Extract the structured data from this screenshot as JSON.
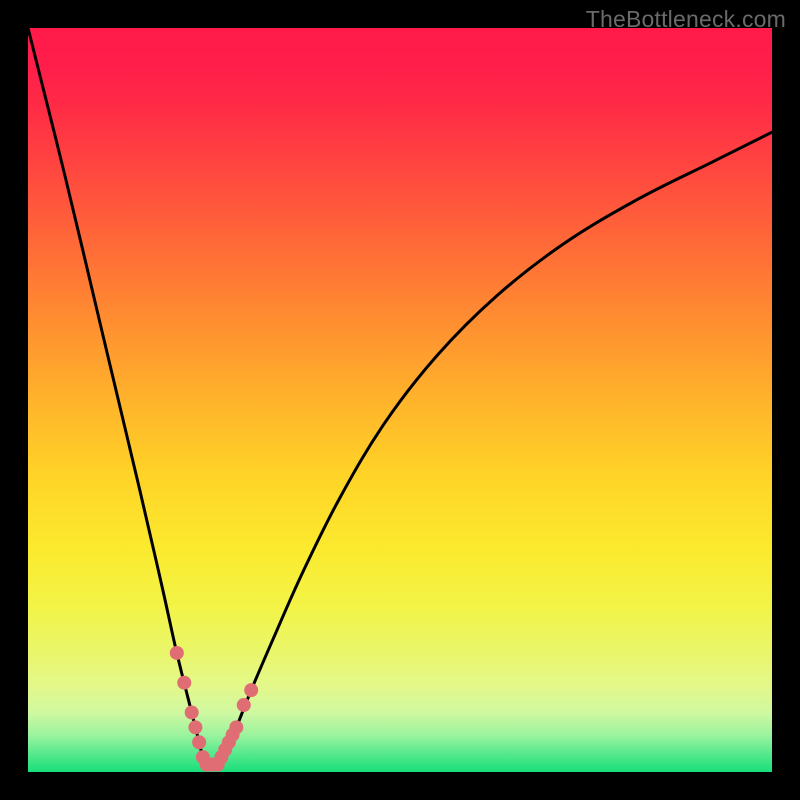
{
  "watermark": "TheBottleneck.com",
  "chart_data": {
    "type": "line",
    "title": "",
    "xlabel": "",
    "ylabel": "",
    "xlim": [
      0,
      100
    ],
    "ylim": [
      0,
      100
    ],
    "series": [
      {
        "name": "curve",
        "x": [
          0,
          5,
          10,
          15,
          18,
          20,
          22,
          23,
          23.5,
          24,
          24.5,
          25,
          25.5,
          26,
          27,
          28,
          30,
          33,
          37,
          42,
          48,
          55,
          63,
          72,
          82,
          92,
          100
        ],
        "values": [
          100,
          80,
          59,
          38,
          25,
          16,
          8,
          4,
          2,
          1,
          1,
          1,
          1,
          2,
          4,
          6,
          11,
          18,
          27,
          37,
          47,
          56,
          64,
          71,
          77,
          82,
          86
        ]
      }
    ],
    "markers": {
      "x": [
        20,
        21,
        22,
        22.5,
        23,
        23.5,
        24,
        24.5,
        25,
        25.5,
        26,
        26.5,
        27,
        27.5,
        28,
        29,
        30
      ],
      "values": [
        16,
        12,
        8,
        6,
        4,
        2,
        1,
        1,
        1,
        1,
        2,
        3,
        4,
        5,
        6,
        9,
        11
      ]
    },
    "gradient_stops": [
      {
        "offset": 0,
        "color": "#ff1a4a"
      },
      {
        "offset": 0.05,
        "color": "#ff1e4a"
      },
      {
        "offset": 0.1,
        "color": "#ff2946"
      },
      {
        "offset": 0.2,
        "color": "#ff4a3f"
      },
      {
        "offset": 0.3,
        "color": "#ff6d37"
      },
      {
        "offset": 0.4,
        "color": "#ff9030"
      },
      {
        "offset": 0.5,
        "color": "#ffb32b"
      },
      {
        "offset": 0.6,
        "color": "#ffd327"
      },
      {
        "offset": 0.7,
        "color": "#fbea2e"
      },
      {
        "offset": 0.78,
        "color": "#f2f448"
      },
      {
        "offset": 0.84,
        "color": "#e9f66b"
      },
      {
        "offset": 0.885,
        "color": "#e3f88a"
      },
      {
        "offset": 0.92,
        "color": "#d0f8a0"
      },
      {
        "offset": 0.95,
        "color": "#9cf39e"
      },
      {
        "offset": 0.975,
        "color": "#58e98e"
      },
      {
        "offset": 1.0,
        "color": "#18de7a"
      }
    ],
    "marker_color": "#e06d74",
    "curve_color": "#000000"
  }
}
